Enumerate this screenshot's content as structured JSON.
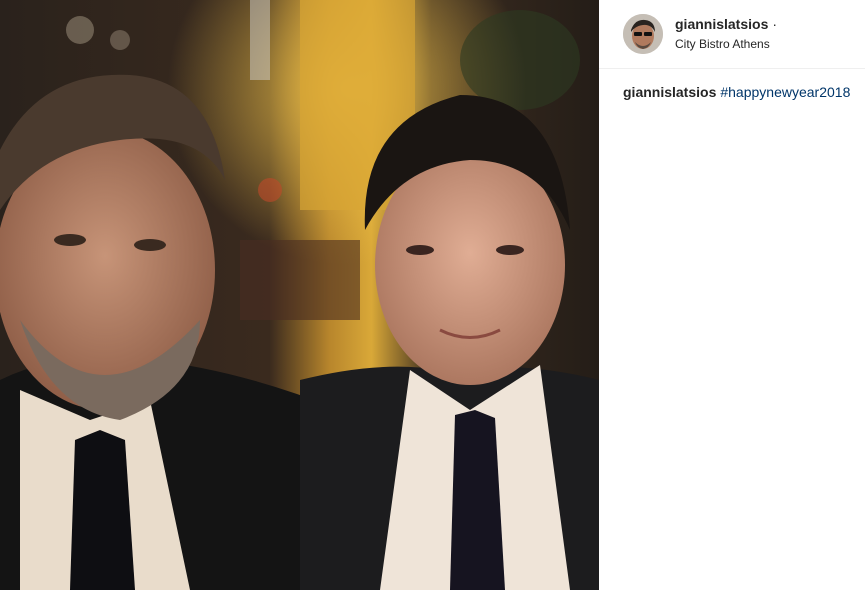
{
  "post": {
    "username": "giannislatsios",
    "separator": "·",
    "location": "City Bistro Athens",
    "caption": {
      "username": "giannislatsios",
      "hashtag": "#happynewyear2018"
    },
    "photo_alt": "photo",
    "avatar_icon": "profile-avatar"
  },
  "colors": {
    "hashtag": "#003569",
    "text": "#262626",
    "divider": "#efefef"
  }
}
